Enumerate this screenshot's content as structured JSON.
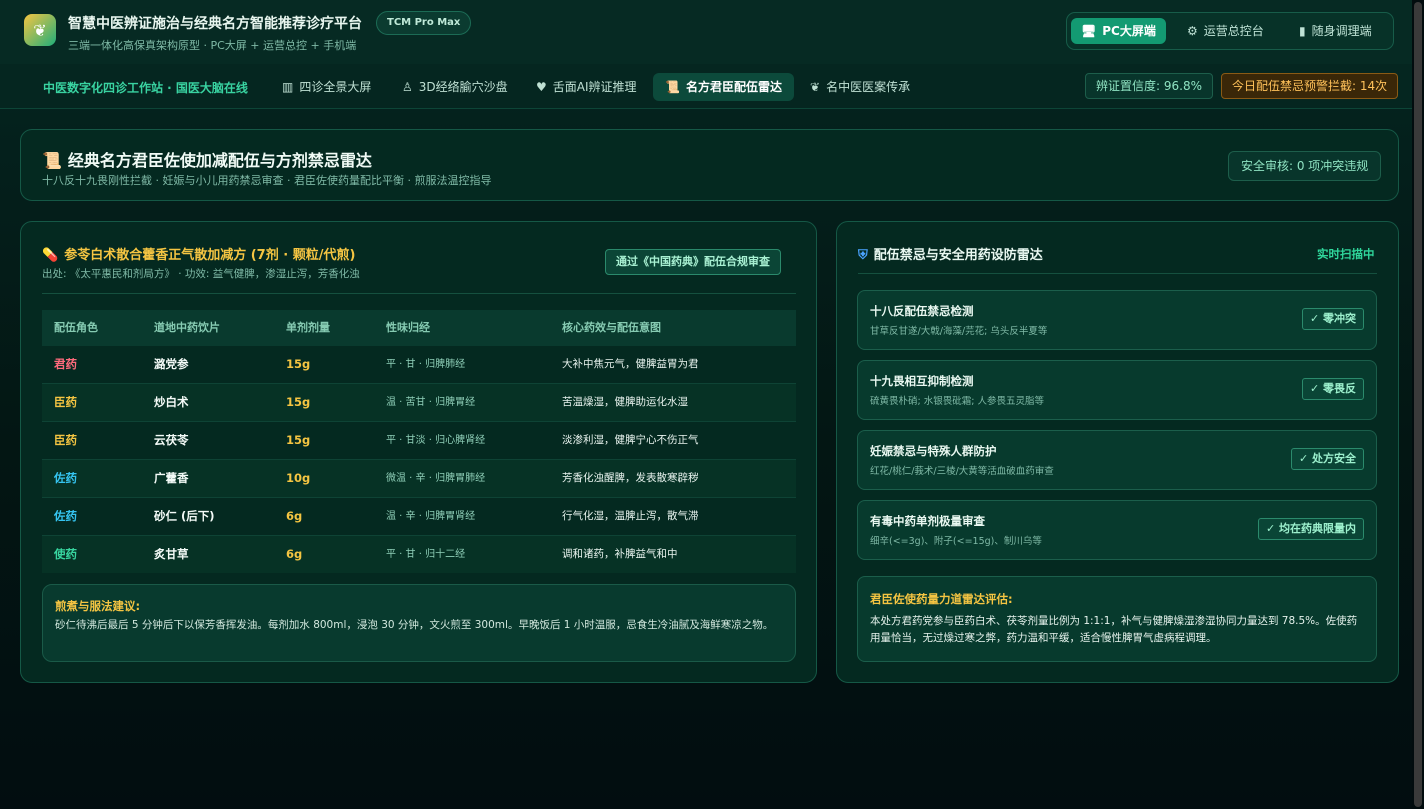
{
  "header": {
    "title": "智慧中医辨证施治与经典名方智能推荐诊疗平台",
    "subtitle": "三端一体化高保真架构原型 · PC大屏 + 运营总控 + 手机端",
    "badge": "TCM Pro Max",
    "modes": [
      {
        "label": "PC大屏端",
        "icon": "monitor-icon"
      },
      {
        "label": "运营总控台",
        "icon": "gear-icon"
      },
      {
        "label": "随身调理端",
        "icon": "phone-icon"
      }
    ]
  },
  "nav": {
    "brand": "中医数字化四诊工作站 · 国医大脑在线",
    "tabs": [
      {
        "label": "四诊全景大屏",
        "icon": "chart-icon"
      },
      {
        "label": "3D经络腧穴沙盘",
        "icon": "meridian-figure-icon"
      },
      {
        "label": "舌面AI辨证推理",
        "icon": "tongue-icon"
      },
      {
        "label": "名方君臣配伍雷达",
        "icon": "scroll-icon"
      },
      {
        "label": "名中医医案传承",
        "icon": "herb-icon"
      }
    ],
    "stat_confidence": "辨证置信度: 96.8%",
    "stat_warning": "今日配伍禁忌预警拦截: 14次"
  },
  "banner": {
    "title": "经典名方君臣佐使加减配伍与方剂禁忌雷达",
    "subtitle": "十八反十九畏刚性拦截 · 妊娠与小儿用药禁忌审查 · 君臣佐使药量配比平衡 · 煎服法温控指导",
    "audit": "安全审核: 0 项冲突违规"
  },
  "formula": {
    "title": "参苓白术散合藿香正气散加减方 (7剂 · 颗粒/代煎)",
    "source": "出处: 《太平惠民和剂局方》 · 功效: 益气健脾，渗湿止泻，芳香化浊",
    "compliance": "通过《中国药典》配伍合规审查",
    "columns": [
      "配伍角色",
      "道地中药饮片",
      "单剂剂量",
      "性味归经",
      "核心药效与配伍意图"
    ],
    "rows": [
      {
        "role": "君药",
        "herb": "潞党参",
        "dose": "15g",
        "nature": "平 · 甘 · 归脾肺经",
        "effect": "大补中焦元气，健脾益胃为君"
      },
      {
        "role": "臣药",
        "herb": "炒白术",
        "dose": "15g",
        "nature": "温 · 苦甘 · 归脾胃经",
        "effect": "苦温燥湿，健脾助运化水湿"
      },
      {
        "role": "臣药",
        "herb": "云茯苓",
        "dose": "15g",
        "nature": "平 · 甘淡 · 归心脾肾经",
        "effect": "淡渗利湿，健脾宁心不伤正气"
      },
      {
        "role": "佐药",
        "herb": "广藿香",
        "dose": "10g",
        "nature": "微温 · 辛 · 归脾胃肺经",
        "effect": "芳香化浊醒脾，发表散寒辟秽"
      },
      {
        "role": "佐药",
        "herb": "砂仁 (后下)",
        "dose": "6g",
        "nature": "温 · 辛 · 归脾胃肾经",
        "effect": "行气化湿，温脾止泻，散气滞"
      },
      {
        "role": "使药",
        "herb": "炙甘草",
        "dose": "6g",
        "nature": "平 · 甘 · 归十二经",
        "effect": "调和诸药，补脾益气和中"
      }
    ],
    "role_colors": {
      "君药": "#ff6b7d",
      "臣药": "#f5c542",
      "佐药": "#35c4f0",
      "使药": "#38d6a0"
    },
    "decoction_title": "煎煮与服法建议:",
    "decoction_text": "砂仁待沸后最后 5 分钟后下以保芳香挥发油。每剂加水 800ml，浸泡 30 分钟，文火煎至 300ml。早晚饭后 1 小时温服，忌食生冷油腻及海鲜寒凉之物。"
  },
  "radar": {
    "title": "配伍禁忌与安全用药设防雷达",
    "status": "实时扫描中",
    "checks": [
      {
        "title": "十八反配伍禁忌检测",
        "desc": "甘草反甘遂/大戟/海藻/芫花; 乌头反半夏等",
        "result": "✓ 零冲突"
      },
      {
        "title": "十九畏相互抑制检测",
        "desc": "硫黄畏朴硝; 水银畏砒霜; 人参畏五灵脂等",
        "result": "✓ 零畏反"
      },
      {
        "title": "妊娠禁忌与特殊人群防护",
        "desc": "红花/桃仁/莪术/三棱/大黄等活血破血药审查",
        "result": "✓ 处方安全"
      },
      {
        "title": "有毒中药单剂极量审查",
        "desc": "细辛(<=3g)、附子(<=15g)、制川乌等",
        "result": "✓ 均在药典限量内"
      }
    ],
    "assessment_title": "君臣佐使药量力道雷达评估:",
    "assessment_text": "本处方君药党参与臣药白术、茯苓剂量比例为 1:1:1，补气与健脾燥湿渗湿协同力量达到 78.5%。佐使药用量恰当，无过燥过寒之弊，药力温和平缓，适合慢性脾胃气虚病程调理。"
  }
}
